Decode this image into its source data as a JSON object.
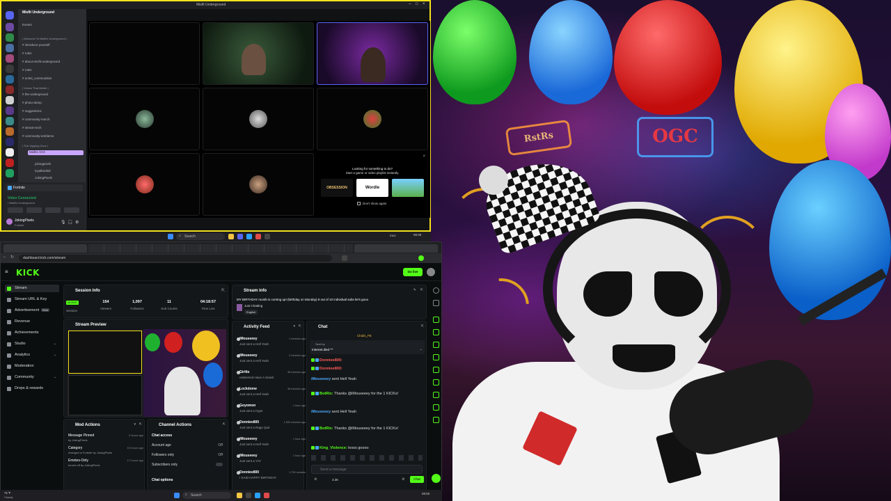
{
  "discord": {
    "title": "Misfit Underground",
    "server_name": "Misfit Underground",
    "events_label": "Events",
    "channels": [
      {
        "label": "| Welcome To Misfit's Underground |",
        "category": true
      },
      {
        "label": "introduce-yourself"
      },
      {
        "label": "rules"
      },
      {
        "label": "about-misfit-underground"
      },
      {
        "label": "roles"
      },
      {
        "label": "unitol_communities"
      },
      {
        "label": "| Voices That Matter |",
        "category": true
      },
      {
        "label": "the-underground"
      },
      {
        "label": "photo-dump"
      },
      {
        "label": "suggestions"
      },
      {
        "label": "community-merch"
      },
      {
        "label": "stream-tech"
      },
      {
        "label": "community-emblems"
      },
      {
        "label": "| The Vapping Zone |",
        "category": true
      }
    ],
    "voice_users": [
      "Misfits XXX",
      "jokingpixels",
      "loyalkiwikid",
      "JokingPixels"
    ],
    "game_label": "Fortnite",
    "voice_status": "Video Connected",
    "voice_sub": "/ Misfit's Underground",
    "user_name": "JokingPixels",
    "user_status": "Fortnite"
  },
  "activity_promo": {
    "title": "Looking for something to do?",
    "subtitle": "Start a game or video playlist instantly.",
    "games": [
      "OBSESSION",
      "Wordle",
      ""
    ],
    "dont_show": "Don't show again"
  },
  "taskbar_top": {
    "search": "Search",
    "lang": "ENG",
    "time": "08:49"
  },
  "kick": {
    "url": "dashboard.kick.com/stream",
    "logo": "KICK",
    "live_label": "Go live",
    "nav": [
      {
        "label": "Stream",
        "active": true
      },
      {
        "label": "Stream URL & Key"
      },
      {
        "label": "Advertisement",
        "beta": "Beta"
      },
      {
        "label": "Revenue"
      },
      {
        "label": "Achievements"
      },
      {
        "label": "Studio",
        "chev": true
      },
      {
        "label": "Analytics",
        "chev": true
      },
      {
        "label": "Moderation"
      },
      {
        "label": "Community",
        "chev": true
      },
      {
        "label": "Drops & rewards"
      }
    ],
    "session": {
      "title": "Session Info",
      "live_badge": "04:18:57",
      "stats": [
        {
          "value": "154",
          "label": "Viewers"
        },
        {
          "value": "1,097",
          "label": "Followers"
        },
        {
          "value": "11",
          "label": "Sub Counts"
        },
        {
          "value": "04:18:57",
          "label": "Time Live"
        }
      ],
      "session_label": "Session"
    },
    "preview_title": "Stream Preview",
    "stream_info": {
      "title": "Stream info",
      "stream_title": "MY BIRTHDAY month is coming up! (birthday on Monday) 8 out of 10 individual subs let's gooo",
      "category": "Just Chatting",
      "language": "English"
    },
    "activity": {
      "title": "Activity Feed",
      "items": [
        {
          "name": "iMouseeey",
          "action": "Just sent a Hell Yeah",
          "time": "1 minutes ago",
          "count": "1"
        },
        {
          "name": "iMouseeey",
          "action": "Just sent a Hell Yeah",
          "time": "2 minutes ago",
          "count": "1"
        },
        {
          "name": "Girlits",
          "action": "redeemed Have A Snack",
          "time": "38 minutes ago",
          "count": ""
        },
        {
          "name": "Lockdonw",
          "action": "Just sent a Hell Yeah",
          "time": "38 minutes ago",
          "count": "1"
        },
        {
          "name": "Goyomon",
          "action": "Just sent a Hype",
          "time": "1 hour ago",
          "count": "10"
        },
        {
          "name": "Donniee800",
          "action": "Just sent a Rage Quit",
          "time": "1,900 minutes ago",
          "count": "500"
        },
        {
          "name": "iMouseeey",
          "action": "Just sent a Hell Yeah",
          "time": "1 hour ago",
          "count": "1"
        },
        {
          "name": "iMouseeey",
          "action": "Just sent a YAY",
          "time": "1 hour ago",
          "count": "1"
        },
        {
          "name": "Donniee800",
          "action": "I SAID HAPPY BIRTHDAY",
          "time": "1,799 minutes",
          "count": ""
        }
      ]
    },
    "chat": {
      "title": "Chat",
      "pinned_user": "Chulis_FE",
      "pinned_label": "Sent by",
      "pinned_text": "Internet died ^^",
      "messages": [
        {
          "user": "Donniee800:",
          "text": "",
          "red": true
        },
        {
          "user": "Donniee800:",
          "text": "",
          "red": true
        },
        {
          "user": "iMouseeey",
          "text": "sent Hell Yeah"
        },
        {
          "user": "BotRix:",
          "text": "Thanks @iMouseeey for the 1 KICKs!"
        },
        {
          "user": "iMouseeey",
          "text": "sent Hell Yeah"
        },
        {
          "user": "BotRix:",
          "text": "Thanks @iMouseeey for the 1 KICKs!"
        },
        {
          "user": "King_Violence:",
          "text": "lesss goooo"
        }
      ],
      "placeholder": "Send a message",
      "viewer_count": "3.3K",
      "send_label": "Chat"
    },
    "mod_actions": {
      "title": "Mod Actions",
      "items": [
        {
          "label": "Message Pinned",
          "sub": "by JokingPixels",
          "time": "2 hours ago"
        },
        {
          "label": "Category",
          "sub": "changed to Fortnite by JokingPixels",
          "time": "15 hours ago"
        },
        {
          "label": "Emotes-Only",
          "sub": "turned off by JokingPixels",
          "time": "17 hours ago"
        }
      ]
    },
    "channel_actions": {
      "title": "Channel Actions",
      "chat_access": "Chat access",
      "rows": [
        {
          "label": "Account age",
          "value": "Off"
        },
        {
          "label": "Followers only",
          "value": "Off"
        },
        {
          "label": "Subscribers only",
          "value": ""
        }
      ],
      "chat_options": "Chat options"
    }
  },
  "taskbar_bottom": {
    "weather": "71°F",
    "weather_sub": "Cloudy",
    "search": "Search",
    "time": "08:50"
  }
}
